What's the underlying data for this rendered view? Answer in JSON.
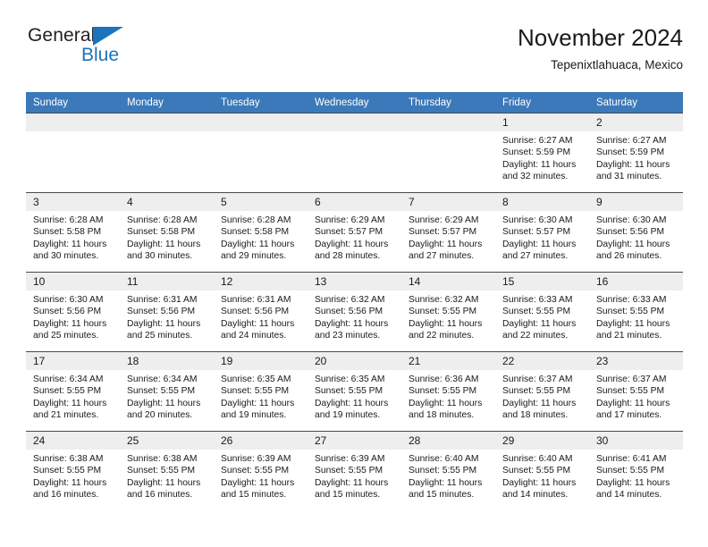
{
  "logo": {
    "word1": "General",
    "word2": "Blue",
    "accent_color": "#1b74bb"
  },
  "header": {
    "title": "November 2024",
    "subtitle": "Tepenixtlahuaca, Mexico"
  },
  "theme": {
    "header_row_bg": "#3b79ba",
    "daynum_bg": "#eeeeee",
    "text_color": "#1a1a1a"
  },
  "weekdays": [
    "Sunday",
    "Monday",
    "Tuesday",
    "Wednesday",
    "Thursday",
    "Friday",
    "Saturday"
  ],
  "weeks": [
    [
      {
        "day": "",
        "empty": true
      },
      {
        "day": "",
        "empty": true
      },
      {
        "day": "",
        "empty": true
      },
      {
        "day": "",
        "empty": true
      },
      {
        "day": "",
        "empty": true
      },
      {
        "day": "1",
        "sunrise": "Sunrise: 6:27 AM",
        "sunset": "Sunset: 5:59 PM",
        "daylight1": "Daylight: 11 hours",
        "daylight2": "and 32 minutes."
      },
      {
        "day": "2",
        "sunrise": "Sunrise: 6:27 AM",
        "sunset": "Sunset: 5:59 PM",
        "daylight1": "Daylight: 11 hours",
        "daylight2": "and 31 minutes."
      }
    ],
    [
      {
        "day": "3",
        "sunrise": "Sunrise: 6:28 AM",
        "sunset": "Sunset: 5:58 PM",
        "daylight1": "Daylight: 11 hours",
        "daylight2": "and 30 minutes."
      },
      {
        "day": "4",
        "sunrise": "Sunrise: 6:28 AM",
        "sunset": "Sunset: 5:58 PM",
        "daylight1": "Daylight: 11 hours",
        "daylight2": "and 30 minutes."
      },
      {
        "day": "5",
        "sunrise": "Sunrise: 6:28 AM",
        "sunset": "Sunset: 5:58 PM",
        "daylight1": "Daylight: 11 hours",
        "daylight2": "and 29 minutes."
      },
      {
        "day": "6",
        "sunrise": "Sunrise: 6:29 AM",
        "sunset": "Sunset: 5:57 PM",
        "daylight1": "Daylight: 11 hours",
        "daylight2": "and 28 minutes."
      },
      {
        "day": "7",
        "sunrise": "Sunrise: 6:29 AM",
        "sunset": "Sunset: 5:57 PM",
        "daylight1": "Daylight: 11 hours",
        "daylight2": "and 27 minutes."
      },
      {
        "day": "8",
        "sunrise": "Sunrise: 6:30 AM",
        "sunset": "Sunset: 5:57 PM",
        "daylight1": "Daylight: 11 hours",
        "daylight2": "and 27 minutes."
      },
      {
        "day": "9",
        "sunrise": "Sunrise: 6:30 AM",
        "sunset": "Sunset: 5:56 PM",
        "daylight1": "Daylight: 11 hours",
        "daylight2": "and 26 minutes."
      }
    ],
    [
      {
        "day": "10",
        "sunrise": "Sunrise: 6:30 AM",
        "sunset": "Sunset: 5:56 PM",
        "daylight1": "Daylight: 11 hours",
        "daylight2": "and 25 minutes."
      },
      {
        "day": "11",
        "sunrise": "Sunrise: 6:31 AM",
        "sunset": "Sunset: 5:56 PM",
        "daylight1": "Daylight: 11 hours",
        "daylight2": "and 25 minutes."
      },
      {
        "day": "12",
        "sunrise": "Sunrise: 6:31 AM",
        "sunset": "Sunset: 5:56 PM",
        "daylight1": "Daylight: 11 hours",
        "daylight2": "and 24 minutes."
      },
      {
        "day": "13",
        "sunrise": "Sunrise: 6:32 AM",
        "sunset": "Sunset: 5:56 PM",
        "daylight1": "Daylight: 11 hours",
        "daylight2": "and 23 minutes."
      },
      {
        "day": "14",
        "sunrise": "Sunrise: 6:32 AM",
        "sunset": "Sunset: 5:55 PM",
        "daylight1": "Daylight: 11 hours",
        "daylight2": "and 22 minutes."
      },
      {
        "day": "15",
        "sunrise": "Sunrise: 6:33 AM",
        "sunset": "Sunset: 5:55 PM",
        "daylight1": "Daylight: 11 hours",
        "daylight2": "and 22 minutes."
      },
      {
        "day": "16",
        "sunrise": "Sunrise: 6:33 AM",
        "sunset": "Sunset: 5:55 PM",
        "daylight1": "Daylight: 11 hours",
        "daylight2": "and 21 minutes."
      }
    ],
    [
      {
        "day": "17",
        "sunrise": "Sunrise: 6:34 AM",
        "sunset": "Sunset: 5:55 PM",
        "daylight1": "Daylight: 11 hours",
        "daylight2": "and 21 minutes."
      },
      {
        "day": "18",
        "sunrise": "Sunrise: 6:34 AM",
        "sunset": "Sunset: 5:55 PM",
        "daylight1": "Daylight: 11 hours",
        "daylight2": "and 20 minutes."
      },
      {
        "day": "19",
        "sunrise": "Sunrise: 6:35 AM",
        "sunset": "Sunset: 5:55 PM",
        "daylight1": "Daylight: 11 hours",
        "daylight2": "and 19 minutes."
      },
      {
        "day": "20",
        "sunrise": "Sunrise: 6:35 AM",
        "sunset": "Sunset: 5:55 PM",
        "daylight1": "Daylight: 11 hours",
        "daylight2": "and 19 minutes."
      },
      {
        "day": "21",
        "sunrise": "Sunrise: 6:36 AM",
        "sunset": "Sunset: 5:55 PM",
        "daylight1": "Daylight: 11 hours",
        "daylight2": "and 18 minutes."
      },
      {
        "day": "22",
        "sunrise": "Sunrise: 6:37 AM",
        "sunset": "Sunset: 5:55 PM",
        "daylight1": "Daylight: 11 hours",
        "daylight2": "and 18 minutes."
      },
      {
        "day": "23",
        "sunrise": "Sunrise: 6:37 AM",
        "sunset": "Sunset: 5:55 PM",
        "daylight1": "Daylight: 11 hours",
        "daylight2": "and 17 minutes."
      }
    ],
    [
      {
        "day": "24",
        "sunrise": "Sunrise: 6:38 AM",
        "sunset": "Sunset: 5:55 PM",
        "daylight1": "Daylight: 11 hours",
        "daylight2": "and 16 minutes."
      },
      {
        "day": "25",
        "sunrise": "Sunrise: 6:38 AM",
        "sunset": "Sunset: 5:55 PM",
        "daylight1": "Daylight: 11 hours",
        "daylight2": "and 16 minutes."
      },
      {
        "day": "26",
        "sunrise": "Sunrise: 6:39 AM",
        "sunset": "Sunset: 5:55 PM",
        "daylight1": "Daylight: 11 hours",
        "daylight2": "and 15 minutes."
      },
      {
        "day": "27",
        "sunrise": "Sunrise: 6:39 AM",
        "sunset": "Sunset: 5:55 PM",
        "daylight1": "Daylight: 11 hours",
        "daylight2": "and 15 minutes."
      },
      {
        "day": "28",
        "sunrise": "Sunrise: 6:40 AM",
        "sunset": "Sunset: 5:55 PM",
        "daylight1": "Daylight: 11 hours",
        "daylight2": "and 15 minutes."
      },
      {
        "day": "29",
        "sunrise": "Sunrise: 6:40 AM",
        "sunset": "Sunset: 5:55 PM",
        "daylight1": "Daylight: 11 hours",
        "daylight2": "and 14 minutes."
      },
      {
        "day": "30",
        "sunrise": "Sunrise: 6:41 AM",
        "sunset": "Sunset: 5:55 PM",
        "daylight1": "Daylight: 11 hours",
        "daylight2": "and 14 minutes."
      }
    ]
  ]
}
